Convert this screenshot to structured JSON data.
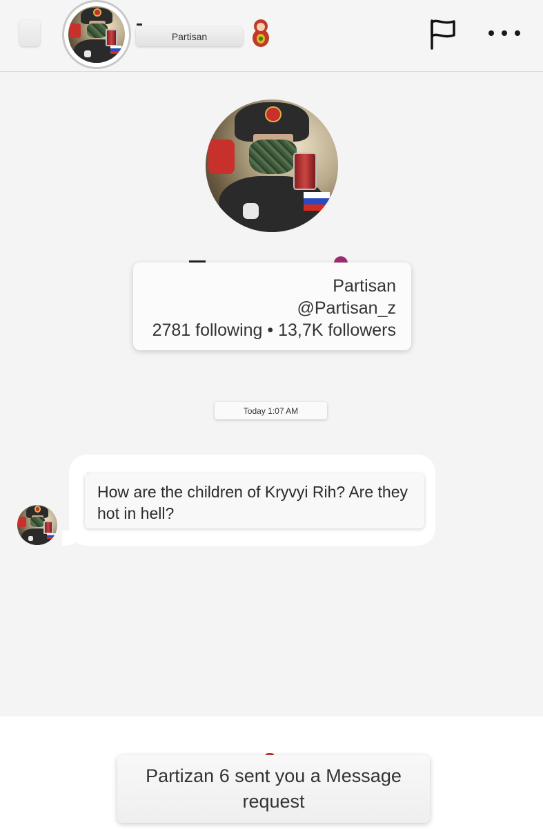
{
  "header": {
    "name_chip": "Partisan",
    "doll_icon": "matryoshka-doll-icon",
    "flag_icon": "flag-icon",
    "more_icon": "more-dots-icon"
  },
  "profile": {
    "display_name": "Partisan",
    "handle": "@Partisan_z",
    "stats": "2781 following • 13,7K followers"
  },
  "conversation": {
    "date_label": "Today 1:07 AM",
    "messages": [
      {
        "text": "How are the children of Kryvyi Rih? Are they hot in hell?"
      }
    ]
  },
  "request_banner": {
    "text": "Partizan 6 sent you a Message request"
  }
}
